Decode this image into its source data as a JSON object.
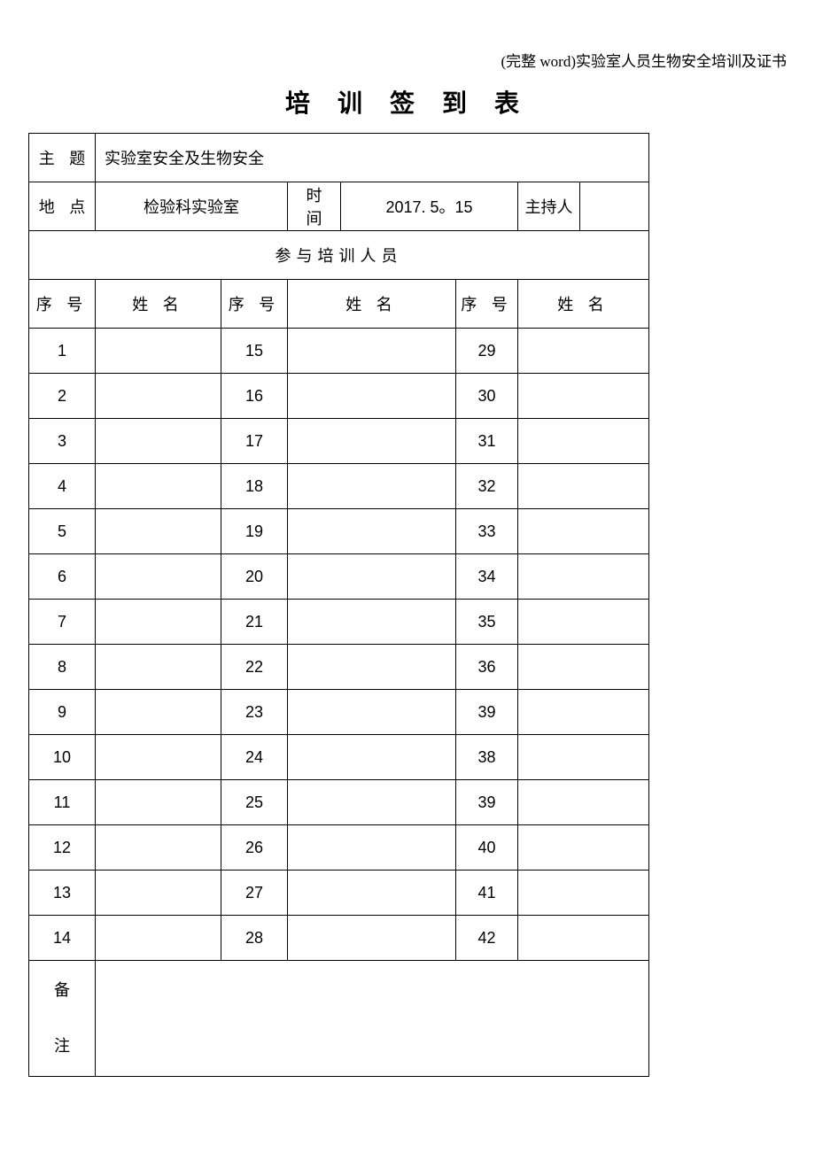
{
  "header_note": "(完整 word)实验室人员生物安全培训及证书",
  "title": "培 训 签 到 表",
  "labels": {
    "topic": "主 题",
    "location": "地 点",
    "time": "时 间",
    "host": "主持人",
    "participants": "参与培训人员",
    "seq": "序 号",
    "name": "姓 名",
    "remark_1": "备",
    "remark_2": "注"
  },
  "info": {
    "topic": "实验室安全及生物安全",
    "location": "检验科实验室",
    "time": "2017. 5。15",
    "host": ""
  },
  "rows": [
    {
      "a": "1",
      "an": "",
      "b": "15",
      "bn": "",
      "c": "29",
      "cn": ""
    },
    {
      "a": "2",
      "an": "",
      "b": "16",
      "bn": "",
      "c": "30",
      "cn": ""
    },
    {
      "a": "3",
      "an": "",
      "b": "17",
      "bn": "",
      "c": "31",
      "cn": ""
    },
    {
      "a": "4",
      "an": "",
      "b": "18",
      "bn": "",
      "c": "32",
      "cn": ""
    },
    {
      "a": "5",
      "an": "",
      "b": "19",
      "bn": "",
      "c": "33",
      "cn": ""
    },
    {
      "a": "6",
      "an": "",
      "b": "20",
      "bn": "",
      "c": "34",
      "cn": ""
    },
    {
      "a": "7",
      "an": "",
      "b": "21",
      "bn": "",
      "c": "35",
      "cn": ""
    },
    {
      "a": "8",
      "an": "",
      "b": "22",
      "bn": "",
      "c": "36",
      "cn": ""
    },
    {
      "a": "9",
      "an": "",
      "b": "23",
      "bn": "",
      "c": "39",
      "cn": ""
    },
    {
      "a": "10",
      "an": "",
      "b": "24",
      "bn": "",
      "c": "38",
      "cn": ""
    },
    {
      "a": "11",
      "an": "",
      "b": "25",
      "bn": "",
      "c": "39",
      "cn": ""
    },
    {
      "a": "12",
      "an": "",
      "b": "26",
      "bn": "",
      "c": "40",
      "cn": ""
    },
    {
      "a": "13",
      "an": "",
      "b": "27",
      "bn": "",
      "c": "41",
      "cn": ""
    },
    {
      "a": "14",
      "an": "",
      "b": "28",
      "bn": "",
      "c": "42",
      "cn": ""
    }
  ],
  "remark": ""
}
